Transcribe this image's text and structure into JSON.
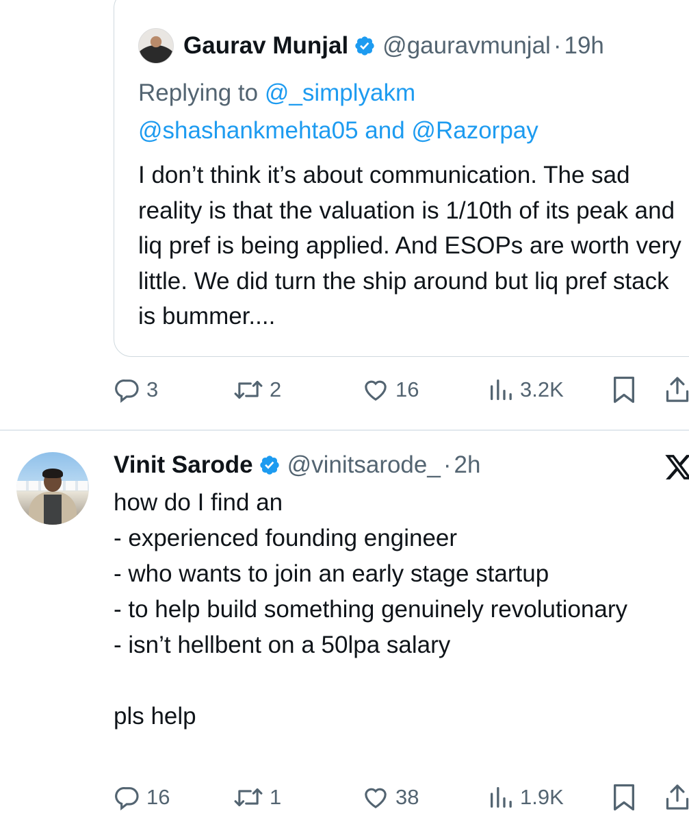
{
  "quoted_tweet": {
    "author_name": "Gaurav Munjal",
    "handle": "@gauravmunjal",
    "separator": "·",
    "time": "19h",
    "replying_prefix": "Replying to ",
    "reply_mention_1": "@_simplyakm",
    "reply_mention_2": "@shashankmehta05",
    "reply_and": " and ",
    "reply_mention_3": "@Razorpay",
    "text": "I don’t think it’s about communication. The sad reality is that the valuation is 1/10th of its peak and liq pref is being applied. And ESOPs are worth very little. We did turn the ship around but liq pref stack is bummer....",
    "stats": {
      "replies": "3",
      "reposts": "2",
      "likes": "16",
      "views": "3.2K"
    }
  },
  "main_tweet": {
    "author_name": "Vinit Sarode",
    "handle": "@vinitsarode_",
    "separator": "·",
    "time": "2h",
    "text": "how do I find an\n- experienced founding engineer\n- who wants to join an early stage startup\n- to help build something genuinely revolutionary\n- isn’t hellbent on a 50lpa salary\n\npls help",
    "stats": {
      "replies": "16",
      "reposts": "1",
      "likes": "38",
      "views": "1.9K"
    }
  },
  "colors": {
    "text": "#0f1419",
    "secondary": "#536471",
    "accent": "#1d9bf0",
    "border": "#cfd9de"
  },
  "icons": [
    "verified-badge-icon",
    "reply-icon",
    "repost-icon",
    "like-icon",
    "views-icon",
    "bookmark-icon",
    "share-icon",
    "x-logo-icon"
  ]
}
